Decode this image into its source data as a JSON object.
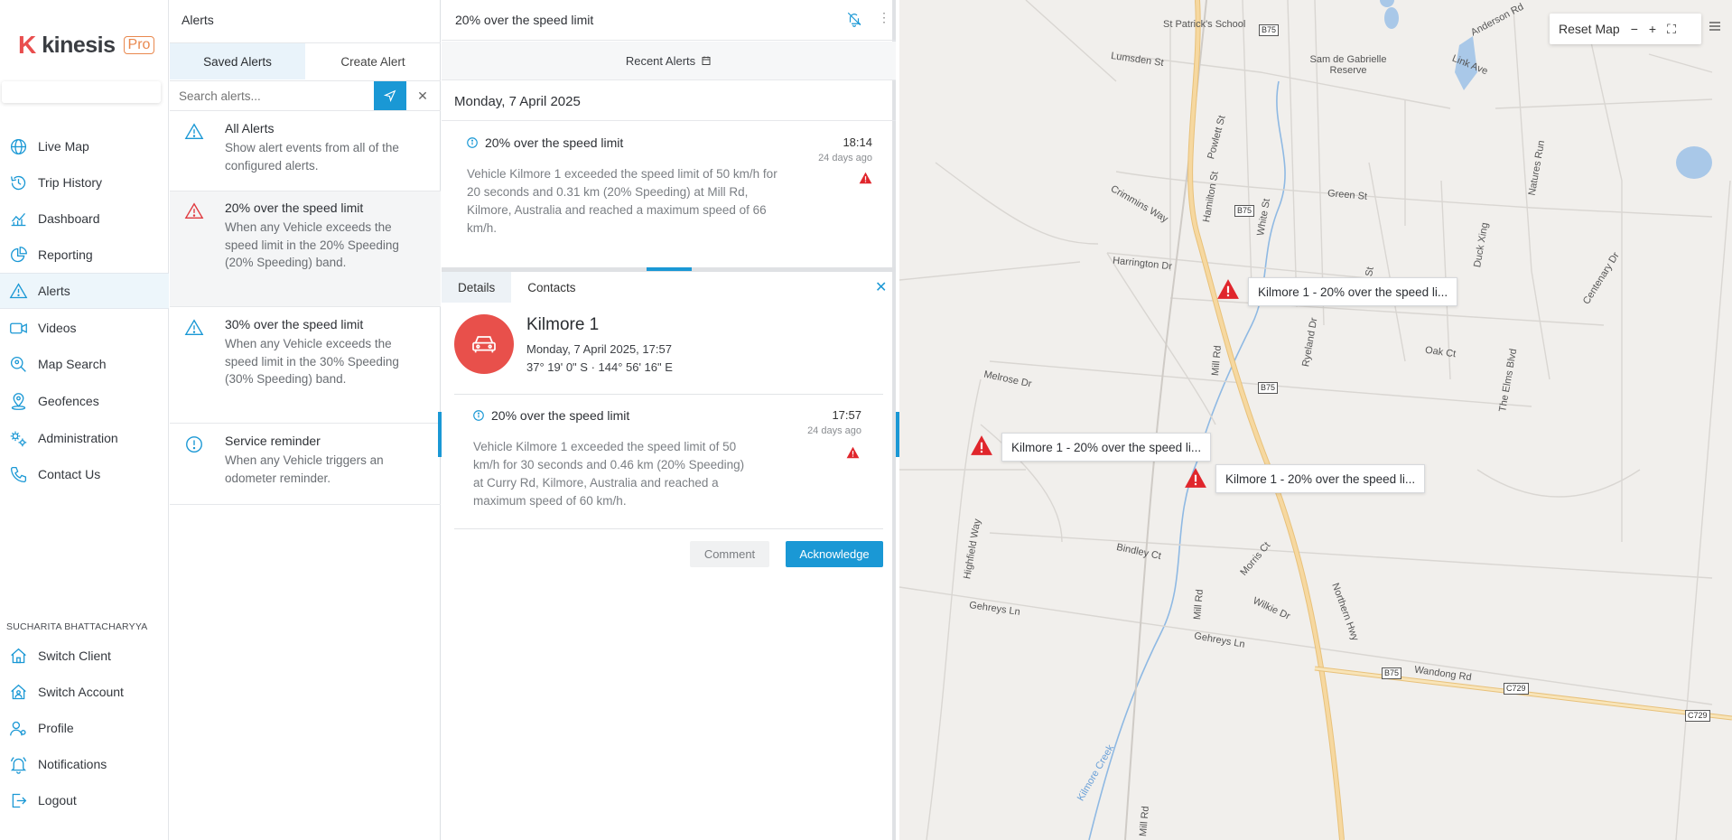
{
  "brand": {
    "name": "kinesis",
    "badge": "Pro",
    "k": "K"
  },
  "nav": {
    "items": [
      {
        "label": "Live Map",
        "icon": "globe-icon"
      },
      {
        "label": "Trip History",
        "icon": "history-icon"
      },
      {
        "label": "Dashboard",
        "icon": "chart-icon"
      },
      {
        "label": "Reporting",
        "icon": "pie-chart-icon"
      },
      {
        "label": "Alerts",
        "icon": "warning-icon"
      },
      {
        "label": "Videos",
        "icon": "video-icon"
      },
      {
        "label": "Map Search",
        "icon": "map-search-icon"
      },
      {
        "label": "Geofences",
        "icon": "geofence-icon"
      },
      {
        "label": "Administration",
        "icon": "admin-gear-icon"
      },
      {
        "label": "Contact Us",
        "icon": "phone-icon"
      }
    ],
    "active": "Alerts",
    "user": "SUCHARITA BHATTACHARYYA",
    "bottom_items": [
      {
        "label": "Switch Client",
        "icon": "home-icon"
      },
      {
        "label": "Switch Account",
        "icon": "account-home-icon"
      },
      {
        "label": "Profile",
        "icon": "profile-icon"
      },
      {
        "label": "Notifications",
        "icon": "bell-icon"
      },
      {
        "label": "Logout",
        "icon": "logout-icon"
      }
    ]
  },
  "alerts_panel": {
    "title": "Alerts",
    "tabs": [
      "Saved Alerts",
      "Create Alert"
    ],
    "search_placeholder": "Search alerts...",
    "items": [
      {
        "title": "All Alerts",
        "desc": "Show alert events from all of the configured alerts.",
        "icon": "warning-outline-icon"
      },
      {
        "title": "20% over the speed limit",
        "desc": "When any Vehicle exceeds the speed limit in the 20% Speeding (20% Speeding) band.",
        "icon": "warning-red-icon"
      },
      {
        "title": "30% over the speed limit",
        "desc": "When any Vehicle exceeds the speed limit in the 30% Speeding (30% Speeding) band.",
        "icon": "warning-outline-icon"
      },
      {
        "title": "Service reminder",
        "desc": "When any Vehicle triggers an odometer reminder.",
        "icon": "info-circle-icon"
      }
    ]
  },
  "detail": {
    "header_title": "20% over the speed limit",
    "recent_label": "Recent Alerts",
    "date_heading": "Monday, 7 April 2025",
    "recent_card": {
      "title": "20% over the speed limit",
      "time": "18:14",
      "ago": "24 days ago",
      "desc": "Vehicle Kilmore 1 exceeded the speed limit of 50 km/h for 20 seconds and 0.31 km (20% Speeding) at Mill Rd, Kilmore, Australia and reached a maximum speed of 66 km/h."
    },
    "tabs": [
      "Details",
      "Contacts"
    ],
    "vehicle": {
      "name": "Kilmore 1",
      "datetime": "Monday, 7 April 2025, 17:57",
      "coords": "37° 19' 0\" S  ·  144° 56' 16\" E"
    },
    "selected_card": {
      "title": "20% over the speed limit",
      "time": "17:57",
      "ago": "24 days ago",
      "desc": "Vehicle Kilmore 1 exceeded the speed limit of 50 km/h for 30 seconds and 0.46 km (20% Speeding) at Curry Rd, Kilmore, Australia and reached a maximum speed of 60 km/h."
    },
    "buttons": {
      "comment": "Comment",
      "acknowledge": "Acknowledge"
    }
  },
  "map": {
    "controls": {
      "reset": "Reset Map",
      "zoom_out": "−",
      "zoom_in": "+",
      "fullscreen": "⛶"
    },
    "markers": [
      {
        "label": "Kilmore 1 - 20% over the speed li..."
      },
      {
        "label": "Kilmore 1 - 20% over the speed li..."
      },
      {
        "label": "Kilmore 1 - 20% over the speed li..."
      }
    ],
    "places": {
      "school": "St Patrick's School",
      "reserve": "Sam de Gabrielle Reserve",
      "anderson": "Anderson Rd",
      "lumsden": "Lumsden St",
      "link": "Link Ave",
      "powlett": "Powlett St",
      "natures": "Natures Run",
      "crimmins": "Crimmins Way",
      "hamilton": "Hamilton St",
      "white": "White St",
      "green": "Green St",
      "harrington": "Harrington Dr",
      "duck": "Duck Xing",
      "centenary": "Centenary Dr",
      "melrose": "Melrose Dr",
      "millrd": "Mill Rd",
      "ryeland": "Ryeland Dr",
      "oak": "Oak Ct",
      "elms": "The Elms Blvd",
      "highfield": "Highfield Way",
      "bindley": "Bindley Ct",
      "morris": "Morris Ct",
      "gehreys": "Gehreys Ln",
      "wilkie": "Wilkie Dr",
      "northern": "Northern Hwy",
      "wandong": "Wandong Rd",
      "creek": "Kilmore Creek",
      "b75": "B75",
      "c729": "C729",
      "st": "St"
    }
  }
}
